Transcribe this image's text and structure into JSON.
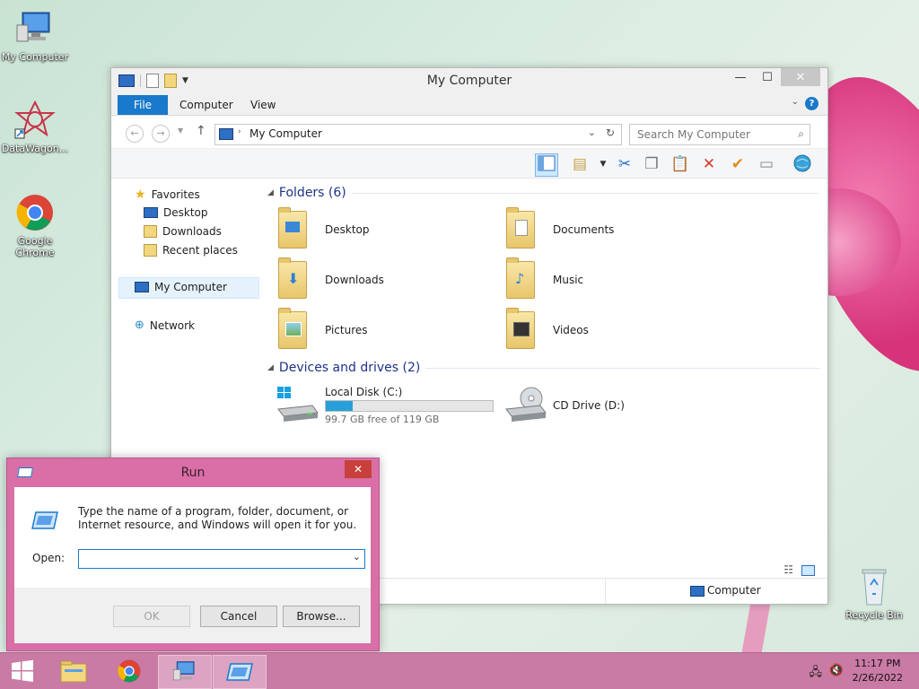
{
  "desktop": {
    "icons": [
      {
        "label": "My Computer"
      },
      {
        "label": "DataWagon..."
      },
      {
        "label": "Google Chrome"
      },
      {
        "label": "Recycle Bin"
      }
    ]
  },
  "explorer": {
    "title": "My Computer",
    "tabs": [
      "File",
      "Computer",
      "View"
    ],
    "address": "My Computer",
    "search_placeholder": "Search My Computer",
    "nav": {
      "favorites": "Favorites",
      "favorites_items": [
        "Desktop",
        "Downloads",
        "Recent places"
      ],
      "computer": "My Computer",
      "network": "Network"
    },
    "folders_header": "Folders (6)",
    "folders": [
      {
        "name": "Desktop"
      },
      {
        "name": "Documents"
      },
      {
        "name": "Downloads"
      },
      {
        "name": "Music"
      },
      {
        "name": "Pictures"
      },
      {
        "name": "Videos"
      }
    ],
    "devices_header": "Devices and drives (2)",
    "drives": [
      {
        "name": "Local Disk (C:)",
        "free_text": "99.7 GB free of 119 GB",
        "used_fraction": 0.16
      },
      {
        "name": "CD Drive (D:)"
      }
    ],
    "status_right": "Computer"
  },
  "run": {
    "title": "Run",
    "description": "Type the name of a program, folder, document, or Internet resource, and Windows will open it for you.",
    "open_label": "Open:",
    "open_value": "",
    "ok": "OK",
    "cancel": "Cancel",
    "browse": "Browse..."
  },
  "taskbar": {
    "time": "11:17 PM",
    "date": "2/26/2022"
  },
  "colors": {
    "accent": "#1979ca",
    "taskbar": "#c97aa5",
    "drive_bar": "#26a0da"
  }
}
